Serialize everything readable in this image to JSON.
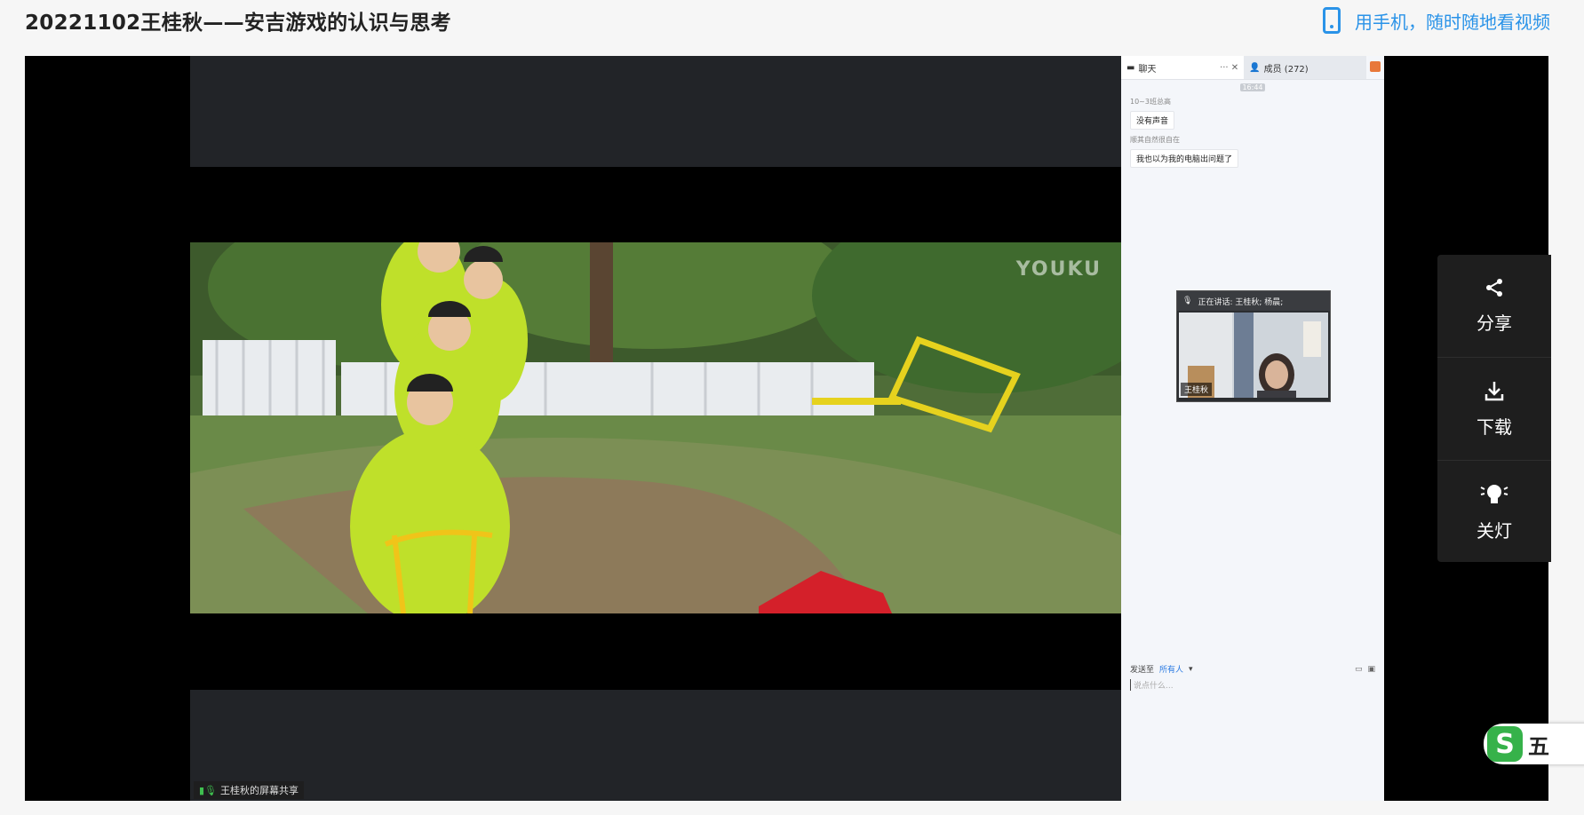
{
  "page": {
    "title": "20221102王桂秋——安吉游戏的认识与思考"
  },
  "mobile": {
    "label": "用手机，随时随地看视频",
    "icon": "phone-icon"
  },
  "video": {
    "watermark": "YOUKU",
    "share_label": "王桂秋的屏幕共享"
  },
  "chat": {
    "tab_chat": "聊天",
    "tab_members": "成员 (272)",
    "time": "16:44",
    "messages": [
      {
        "sender": "10~3班总高",
        "text": "没有声音"
      },
      {
        "sender": "顺其自然很自在",
        "text": "我也以为我的电脑出问题了"
      }
    ],
    "speaking": "正在讲话: 王桂秋; 杨晨;",
    "speaker_name": "王桂秋",
    "send_to_label": "发送至",
    "send_to_value": "所有人",
    "input_placeholder": "说点什么..."
  },
  "toolbar": {
    "share": "分享",
    "download": "下载",
    "lights_off": "关灯"
  },
  "ime": {
    "logo": "S",
    "label": "五"
  },
  "colors": {
    "accent": "#2a93e8",
    "ime_green": "#36b24a",
    "toolbar_bg": "#1e1e1e"
  }
}
